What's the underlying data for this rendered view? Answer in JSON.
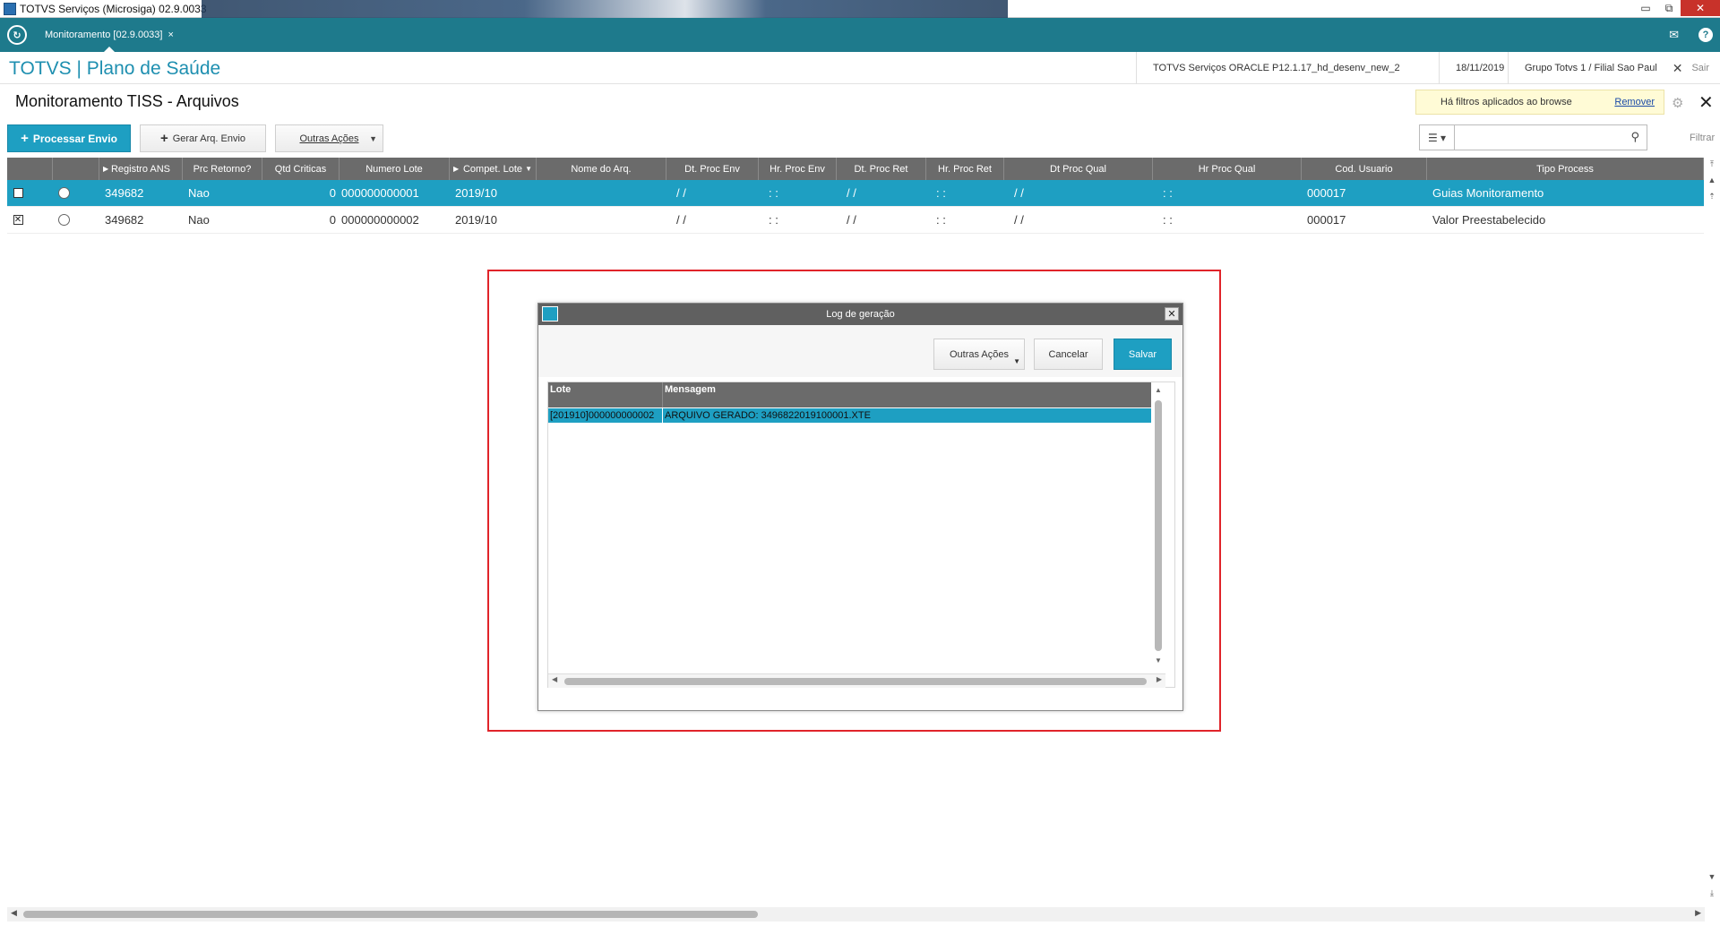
{
  "os": {
    "title": "TOTVS Serviços (Microsiga) 02.9.0033",
    "minimize": "▭",
    "restore": "⧉",
    "close": "✕"
  },
  "app_tabs": [
    {
      "label": "Monitoramento [02.9.0033]",
      "close": "×"
    }
  ],
  "header": {
    "brand": "TOTVS | Plano de Saúde",
    "environment": "TOTVS Serviços ORACLE P12.1.17_hd_desenv_new_2",
    "date": "18/11/2019",
    "company": "Grupo Totvs 1 / Filial Sao Paul",
    "exit_label": "Sair"
  },
  "page": {
    "title": "Monitoramento TISS - Arquivos",
    "filter_note": "Há filtros aplicados ao browse",
    "filter_remove": "Remover",
    "filter_label": "Filtrar",
    "search_placeholder": ""
  },
  "toolbar": {
    "process_send": "Processar Envio",
    "generate_file": "Gerar Arq. Envio",
    "other_actions": "Outras Ações"
  },
  "grid": {
    "columns": [
      "",
      "",
      "Registro ANS",
      "Prc Retorno?",
      "Qtd Criticas",
      "Numero Lote",
      "Compet. Lote",
      "Nome do Arq.",
      "Dt. Proc Env",
      "Hr. Proc Env",
      "Dt. Proc Ret",
      "Hr. Proc Ret",
      "Dt Proc Qual",
      "Hr Proc Qual",
      "Cod. Usuario",
      "Tipo Process"
    ],
    "rows": [
      {
        "checked": "",
        "registro": "349682",
        "prc_retorno": "Nao",
        "qtd_criticas": "0",
        "numero_lote": "000000000001",
        "compet_lote": "2019/10",
        "nome_arq": "",
        "dt_proc_env": "/ /",
        "hr_proc_env": ": :",
        "dt_proc_ret": "/ /",
        "hr_proc_ret": ": :",
        "dt_proc_qual": "/ /",
        "hr_proc_qual": ": :",
        "cod_usuario": "000017",
        "tipo_process": "Guias Monitoramento"
      },
      {
        "checked": "✕",
        "registro": "349682",
        "prc_retorno": "Nao",
        "qtd_criticas": "0",
        "numero_lote": "000000000002",
        "compet_lote": "2019/10",
        "nome_arq": "",
        "dt_proc_env": "/ /",
        "hr_proc_env": ": :",
        "dt_proc_ret": "/ /",
        "hr_proc_ret": ": :",
        "dt_proc_qual": "/ /",
        "hr_proc_qual": ": :",
        "cod_usuario": "000017",
        "tipo_process": "Valor Preestabelecido"
      }
    ]
  },
  "modal": {
    "title": "Log de geração",
    "close": "✕",
    "other_actions": "Outras Ações",
    "cancel": "Cancelar",
    "save": "Salvar",
    "columns": [
      "Lote",
      "Mensagem"
    ],
    "rows": [
      {
        "lote": "[201910]000000000002",
        "mensagem": "ARQUIVO GERADO: 3496822019100001.XTE"
      }
    ]
  },
  "icons": {
    "app_logo": "refresh-circle-icon",
    "mail": "envelope-icon",
    "help": "question-icon",
    "gear": "gear-icon",
    "search": "magnifier-icon"
  },
  "colors": {
    "teal_bar": "#1e7a8c",
    "accent": "#1e9fc2",
    "header_gray": "#6b6b6b",
    "highlight": "#e0242a"
  }
}
